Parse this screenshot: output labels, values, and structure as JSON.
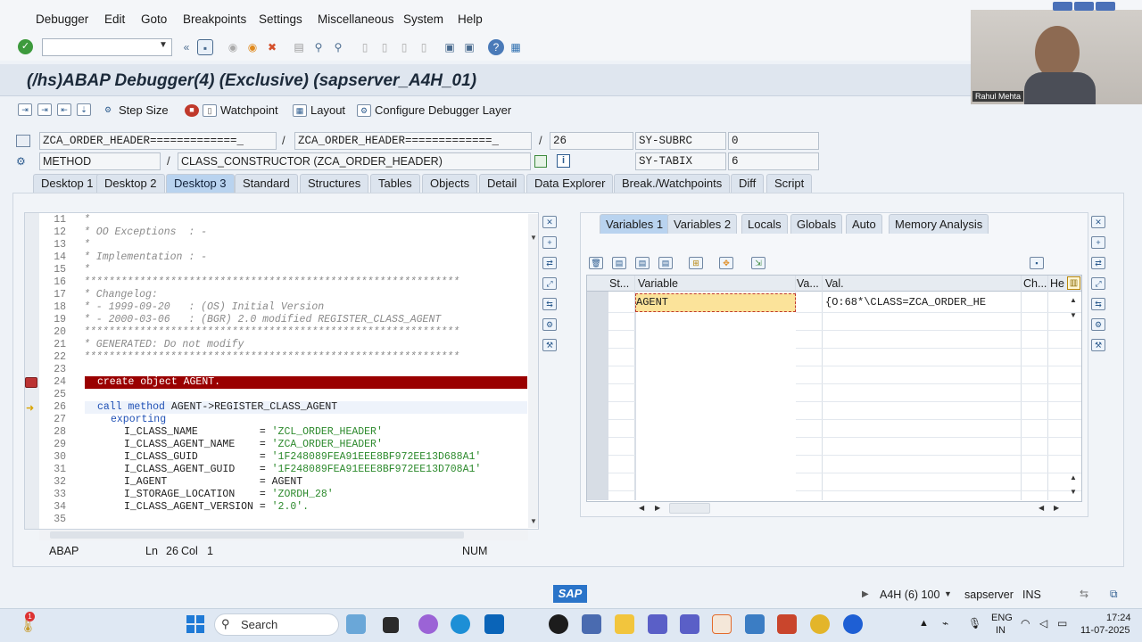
{
  "menu": [
    "Debugger",
    "Edit",
    "Goto",
    "Breakpoints",
    "Settings",
    "Miscellaneous",
    "System",
    "Help"
  ],
  "title": "(/hs)ABAP Debugger(4)  (Exclusive) (sapserver_A4H_01)",
  "app_toolbar": {
    "step_size": "Step Size",
    "watchpoint": "Watchpoint",
    "layout": "Layout",
    "configure": "Configure Debugger Layer"
  },
  "fields": {
    "program": "ZCA_ORDER_HEADER=============_",
    "include": "ZCA_ORDER_HEADER=============_",
    "line": "26",
    "sy_subrc_label": "SY-SUBRC",
    "sy_subrc_value": "0",
    "event_type": "METHOD",
    "event": "CLASS_CONSTRUCTOR (ZCA_ORDER_HEADER)",
    "sy_tabix_label": "SY-TABIX",
    "sy_tabix_value": "6",
    "slash": "/"
  },
  "tabs": [
    "Desktop 1",
    "Desktop 2",
    "Desktop 3",
    "Standard",
    "Structures",
    "Tables",
    "Objects",
    "Detail",
    "Data Explorer",
    "Break./Watchpoints",
    "Diff",
    "Script"
  ],
  "active_tab": "Desktop 3",
  "code": {
    "line_numbers": [
      "11",
      "12",
      "13",
      "14",
      "15",
      "16",
      "17",
      "18",
      "19",
      "20",
      "21",
      "22",
      "23",
      "24",
      "25",
      "26",
      "27",
      "28",
      "29",
      "30",
      "31",
      "32",
      "33",
      "34",
      "35"
    ],
    "l11": "*",
    "l12": "* OO Exceptions  : -",
    "l13": "*",
    "l14": "* Implementation : -",
    "l15": "*",
    "l16": "*************************************************************",
    "l17": "* Changelog:",
    "l18": "* - 1999-09-20   : (OS) Initial Version",
    "l19": "* - 2000-03-06   : (BGR) 2.0 modified REGISTER_CLASS_AGENT",
    "l20": "*************************************************************",
    "l21": "* GENERATED: Do not modify",
    "l22": "*************************************************************",
    "l24": "create object AGENT.",
    "l26_kw": "call method",
    "l26_rest": " AGENT->REGISTER_CLASS_AGENT",
    "l27": "exporting",
    "params": [
      {
        "name": "I_CLASS_NAME          ",
        "eq": "= ",
        "val": "'ZCL_ORDER_HEADER'"
      },
      {
        "name": "I_CLASS_AGENT_NAME    ",
        "eq": "= ",
        "val": "'ZCA_ORDER_HEADER'"
      },
      {
        "name": "I_CLASS_GUID          ",
        "eq": "= ",
        "val": "'1F248089FEA91EEE8BF972EE13D688A1'"
      },
      {
        "name": "I_CLASS_AGENT_GUID    ",
        "eq": "= ",
        "val": "'1F248089FEA91EEE8BF972EE13D708A1'"
      },
      {
        "name": "I_AGENT               ",
        "eq": "= ",
        "val": "AGENT"
      },
      {
        "name": "I_STORAGE_LOCATION    ",
        "eq": "= ",
        "val": "'ZORDH_28'"
      },
      {
        "name": "I_CLASS_AGENT_VERSION ",
        "eq": "= ",
        "val": "'2.0'."
      }
    ]
  },
  "status_bar": {
    "lang": "ABAP",
    "ln_label": "Ln",
    "ln": "26",
    "col_label": "Col",
    "col": "1",
    "mode": "NUM"
  },
  "var_tabs": [
    "Variables 1",
    "Variables 2",
    "Locals",
    "Globals",
    "Auto",
    "Memory Analysis"
  ],
  "var_table": {
    "headers": [
      "St...",
      "Variable",
      "Va...",
      "Val.",
      "Ch...",
      "He"
    ],
    "rows": [
      {
        "variable": "AGENT",
        "value": "{O:68*\\CLASS=ZCA_ORDER_HE"
      }
    ]
  },
  "footer": {
    "sap": "SAP",
    "system": "A4H (6) 100",
    "server": "sapserver",
    "ins": "INS"
  },
  "taskbar": {
    "search": "Search",
    "lang1": "ENG",
    "lang2": "IN",
    "time": "17:24",
    "date": "11-07-2025",
    "badge": "1"
  },
  "webcam": {
    "name": "Rahul Mehta"
  }
}
